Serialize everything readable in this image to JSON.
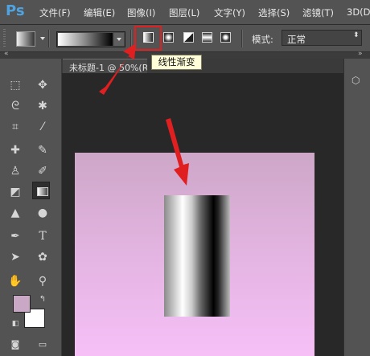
{
  "app": {
    "logo": "Ps"
  },
  "menu": [
    "文件(F)",
    "编辑(E)",
    "图像(I)",
    "图层(L)",
    "文字(Y)",
    "选择(S)",
    "滤镜(T)",
    "3D(D)"
  ],
  "options": {
    "mode_label": "模式:",
    "mode_value": "正常",
    "gradient_types": [
      "linear",
      "radial",
      "angle",
      "reflected",
      "diamond"
    ],
    "tooltip": "线性渐变"
  },
  "document": {
    "tab_title": "未标题-1 @ 50%(RG"
  },
  "colors": {
    "accent_highlight": "#e02020",
    "foreground": "#c9a8c6",
    "background": "#ffffff",
    "canvas_top": "#cda7c8",
    "canvas_bottom": "#f6c0f7"
  },
  "tools": [
    "marquee-icon",
    "move-icon",
    "lasso-icon",
    "magic-wand-icon",
    "crop-icon",
    "eyedropper-icon",
    "healing-brush-icon",
    "brush-icon",
    "clone-stamp-icon",
    "history-brush-icon",
    "eraser-icon",
    "gradient-icon",
    "blur-icon",
    "dodge-icon",
    "pen-icon",
    "type-icon",
    "path-select-icon",
    "shape-icon",
    "hand-icon",
    "zoom-icon"
  ]
}
